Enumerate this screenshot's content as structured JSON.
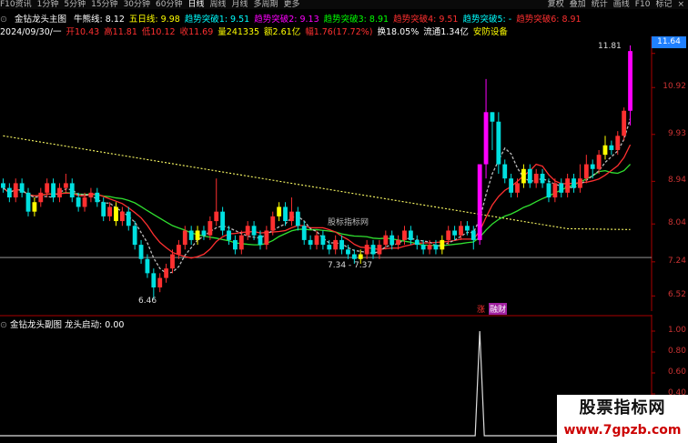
{
  "toolbar": {
    "items": [
      "F10资讯",
      "1分钟",
      "5分钟",
      "15分钟",
      "30分钟",
      "60分钟",
      "日线",
      "周线",
      "月线",
      "多周期",
      "更多"
    ],
    "active_index": 6,
    "right_items": [
      "复权",
      "叠加",
      "统计",
      "画线",
      "F10",
      "标记"
    ],
    "close_label": "×"
  },
  "main_legend": {
    "indicator_name": "金钻龙头主图",
    "items": [
      {
        "label": "牛熊线: 8.12",
        "color": "#ffffff"
      },
      {
        "label": "五日线: 9.98",
        "color": "#ffff00"
      },
      {
        "label": "趋势突破1: 9.51",
        "color": "#00ffff"
      },
      {
        "label": "趋势突破2: 9.13",
        "color": "#ff00ff"
      },
      {
        "label": "趋势突破3: 8.91",
        "color": "#00ff00"
      },
      {
        "label": "趋势突破4: 9.51",
        "color": "#ff3030"
      },
      {
        "label": "趋势突破5: -",
        "color": "#00ffff"
      },
      {
        "label": "趋势突破6: 8.91",
        "color": "#ff3030"
      }
    ]
  },
  "info_row": {
    "items": [
      {
        "label": "2024/09/30/一",
        "color": "#ffffff"
      },
      {
        "label": "开10.43",
        "color": "#ff3030"
      },
      {
        "label": "高11.81",
        "color": "#ff3030"
      },
      {
        "label": "低10.12",
        "color": "#ff3030"
      },
      {
        "label": "收11.69",
        "color": "#ff3030"
      },
      {
        "label": "量241335",
        "color": "#ffff00"
      },
      {
        "label": "额2.61亿",
        "color": "#ffff00"
      },
      {
        "label": "幅1.76(17.72%)",
        "color": "#ff3030"
      },
      {
        "label": "换18.05%",
        "color": "#ffffff"
      },
      {
        "label": "流通1.34亿",
        "color": "#ffffff"
      },
      {
        "label": "安防设备",
        "color": "#ffff00"
      }
    ]
  },
  "price_axis": [
    "11.64",
    "10.92",
    "9.93",
    "8.94",
    "8.04",
    "7.24",
    "6.52"
  ],
  "sub_axis": [
    "1.00",
    "0.80",
    "0.60",
    "0.40",
    "0.20"
  ],
  "colors": {
    "up": "#ff3030",
    "down": "#00e0e0",
    "magenta": "#ff00ff",
    "yellow": "#ffff00"
  },
  "annotations": {
    "high": "11.81",
    "low": "6.46",
    "range": "7.34 - 7.37",
    "watermark_center": "股标指标网",
    "tag_up": "涨",
    "tag_fin": "融财"
  },
  "sub_legend": {
    "name": "金钻龙头副图",
    "value": "龙头启动: 0.00"
  },
  "watermark": {
    "line1": "股票指标网",
    "line2": "www.7gpzb.com"
  },
  "chart_data": {
    "type": "candlestick",
    "price_range": [
      6.2,
      12.0
    ],
    "candles": [
      [
        8.9,
        8.8,
        9.0,
        8.7
      ],
      [
        8.8,
        8.6,
        8.9,
        8.5
      ],
      [
        8.6,
        8.9,
        9.0,
        8.5
      ],
      [
        8.9,
        8.7,
        9.0,
        8.6
      ],
      [
        8.7,
        8.3,
        8.8,
        8.2
      ],
      [
        8.3,
        8.5,
        8.6,
        8.2
      ],
      [
        8.5,
        8.7,
        8.8,
        8.4
      ],
      [
        8.7,
        8.9,
        9.0,
        8.6
      ],
      [
        8.9,
        8.6,
        9.0,
        8.5
      ],
      [
        8.6,
        8.8,
        8.9,
        8.5
      ],
      [
        8.8,
        8.9,
        9.1,
        8.7
      ],
      [
        8.9,
        8.6,
        9.0,
        8.5
      ],
      [
        8.6,
        8.4,
        8.7,
        8.3
      ],
      [
        8.4,
        8.6,
        8.7,
        8.3
      ],
      [
        8.6,
        8.7,
        8.8,
        8.5
      ],
      [
        8.7,
        8.5,
        8.8,
        8.4
      ],
      [
        8.5,
        8.2,
        8.6,
        8.1
      ],
      [
        8.2,
        8.4,
        8.5,
        8.1
      ],
      [
        8.4,
        8.1,
        8.5,
        8.0
      ],
      [
        8.1,
        8.3,
        8.4,
        8.0
      ],
      [
        8.3,
        8.0,
        8.4,
        7.9
      ],
      [
        8.0,
        7.6,
        8.1,
        7.5
      ],
      [
        7.6,
        7.3,
        7.7,
        7.2
      ],
      [
        7.3,
        7.0,
        7.4,
        6.9
      ],
      [
        7.0,
        6.7,
        7.1,
        6.46
      ],
      [
        6.7,
        6.9,
        7.0,
        6.6
      ],
      [
        6.9,
        7.1,
        7.2,
        6.8
      ],
      [
        7.1,
        7.4,
        7.5,
        7.0
      ],
      [
        7.4,
        7.6,
        7.7,
        7.3
      ],
      [
        7.6,
        7.9,
        8.0,
        7.5
      ],
      [
        7.9,
        7.7,
        8.0,
        7.6
      ],
      [
        7.7,
        7.9,
        8.0,
        7.6
      ],
      [
        7.9,
        7.8,
        8.0,
        7.7
      ],
      [
        7.8,
        8.1,
        8.2,
        7.7
      ],
      [
        8.1,
        8.3,
        9.0,
        8.0
      ],
      [
        8.3,
        7.9,
        8.4,
        7.8
      ],
      [
        7.9,
        7.7,
        8.0,
        7.6
      ],
      [
        7.7,
        7.5,
        7.8,
        7.4
      ],
      [
        7.5,
        7.8,
        7.9,
        7.4
      ],
      [
        7.8,
        8.0,
        8.1,
        7.7
      ],
      [
        8.0,
        7.8,
        8.1,
        7.7
      ],
      [
        7.8,
        7.6,
        7.9,
        7.5
      ],
      [
        7.6,
        7.9,
        8.0,
        7.5
      ],
      [
        7.9,
        8.2,
        8.3,
        7.8
      ],
      [
        8.2,
        8.4,
        8.5,
        8.1
      ],
      [
        8.4,
        8.1,
        8.5,
        8.0
      ],
      [
        8.1,
        8.3,
        8.6,
        8.0
      ],
      [
        8.3,
        8.0,
        8.4,
        7.9
      ],
      [
        8.0,
        7.7,
        8.1,
        7.6
      ],
      [
        7.7,
        7.6,
        7.8,
        7.5
      ],
      [
        7.6,
        7.8,
        7.9,
        7.5
      ],
      [
        7.8,
        7.6,
        7.9,
        7.5
      ],
      [
        7.6,
        7.5,
        7.7,
        7.4
      ],
      [
        7.5,
        7.7,
        7.8,
        7.4
      ],
      [
        7.7,
        7.5,
        7.8,
        7.4
      ],
      [
        7.5,
        7.4,
        7.6,
        7.3
      ],
      [
        7.4,
        7.3,
        7.5,
        7.2
      ],
      [
        7.3,
        7.4,
        7.5,
        7.2
      ],
      [
        7.4,
        7.6,
        7.7,
        7.3
      ],
      [
        7.6,
        7.4,
        7.7,
        7.3
      ],
      [
        7.4,
        7.6,
        7.7,
        7.3
      ],
      [
        7.6,
        7.8,
        7.9,
        7.5
      ],
      [
        7.8,
        7.6,
        7.9,
        7.5
      ],
      [
        7.6,
        7.7,
        7.8,
        7.5
      ],
      [
        7.7,
        7.9,
        8.0,
        7.6
      ],
      [
        7.9,
        7.7,
        8.0,
        7.6
      ],
      [
        7.7,
        7.6,
        7.8,
        7.5
      ],
      [
        7.6,
        7.5,
        7.7,
        7.4
      ],
      [
        7.5,
        7.6,
        7.7,
        7.4
      ],
      [
        7.6,
        7.5,
        7.7,
        7.4
      ],
      [
        7.5,
        7.7,
        7.8,
        7.4
      ],
      [
        7.7,
        7.9,
        8.0,
        7.6
      ],
      [
        7.9,
        7.8,
        8.0,
        7.7
      ],
      [
        7.8,
        8.0,
        8.1,
        7.7
      ],
      [
        8.0,
        7.9,
        8.1,
        7.8
      ],
      [
        7.9,
        7.7,
        8.0,
        7.5
      ],
      [
        7.7,
        9.3,
        9.3,
        7.6
      ],
      [
        9.3,
        10.4,
        11.1,
        9.0
      ],
      [
        10.4,
        10.2,
        10.4,
        9.6
      ],
      [
        10.2,
        9.3,
        10.4,
        9.1
      ],
      [
        9.3,
        9.0,
        9.4,
        8.9
      ],
      [
        9.0,
        8.7,
        9.1,
        8.6
      ],
      [
        8.7,
        8.9,
        9.0,
        8.6
      ],
      [
        8.9,
        9.2,
        9.3,
        8.8
      ],
      [
        9.2,
        8.9,
        9.3,
        8.8
      ],
      [
        8.9,
        9.1,
        9.2,
        8.8
      ],
      [
        9.1,
        8.9,
        9.2,
        8.8
      ],
      [
        8.9,
        8.6,
        9.0,
        8.5
      ],
      [
        8.6,
        8.9,
        9.0,
        8.5
      ],
      [
        8.9,
        8.7,
        9.0,
        8.6
      ],
      [
        8.7,
        9.0,
        9.1,
        8.6
      ],
      [
        9.0,
        8.8,
        9.1,
        8.7
      ],
      [
        8.8,
        9.0,
        9.3,
        8.7
      ],
      [
        9.0,
        9.3,
        9.5,
        8.9
      ],
      [
        9.3,
        9.2,
        9.4,
        9.0
      ],
      [
        9.2,
        9.5,
        9.6,
        9.1
      ],
      [
        9.5,
        9.7,
        9.9,
        9.4
      ],
      [
        9.7,
        9.6,
        9.8,
        9.5
      ],
      [
        9.6,
        9.9,
        10.0,
        9.5
      ],
      [
        9.9,
        10.43,
        10.5,
        9.8
      ],
      [
        10.43,
        11.69,
        11.81,
        10.12
      ]
    ]
  }
}
